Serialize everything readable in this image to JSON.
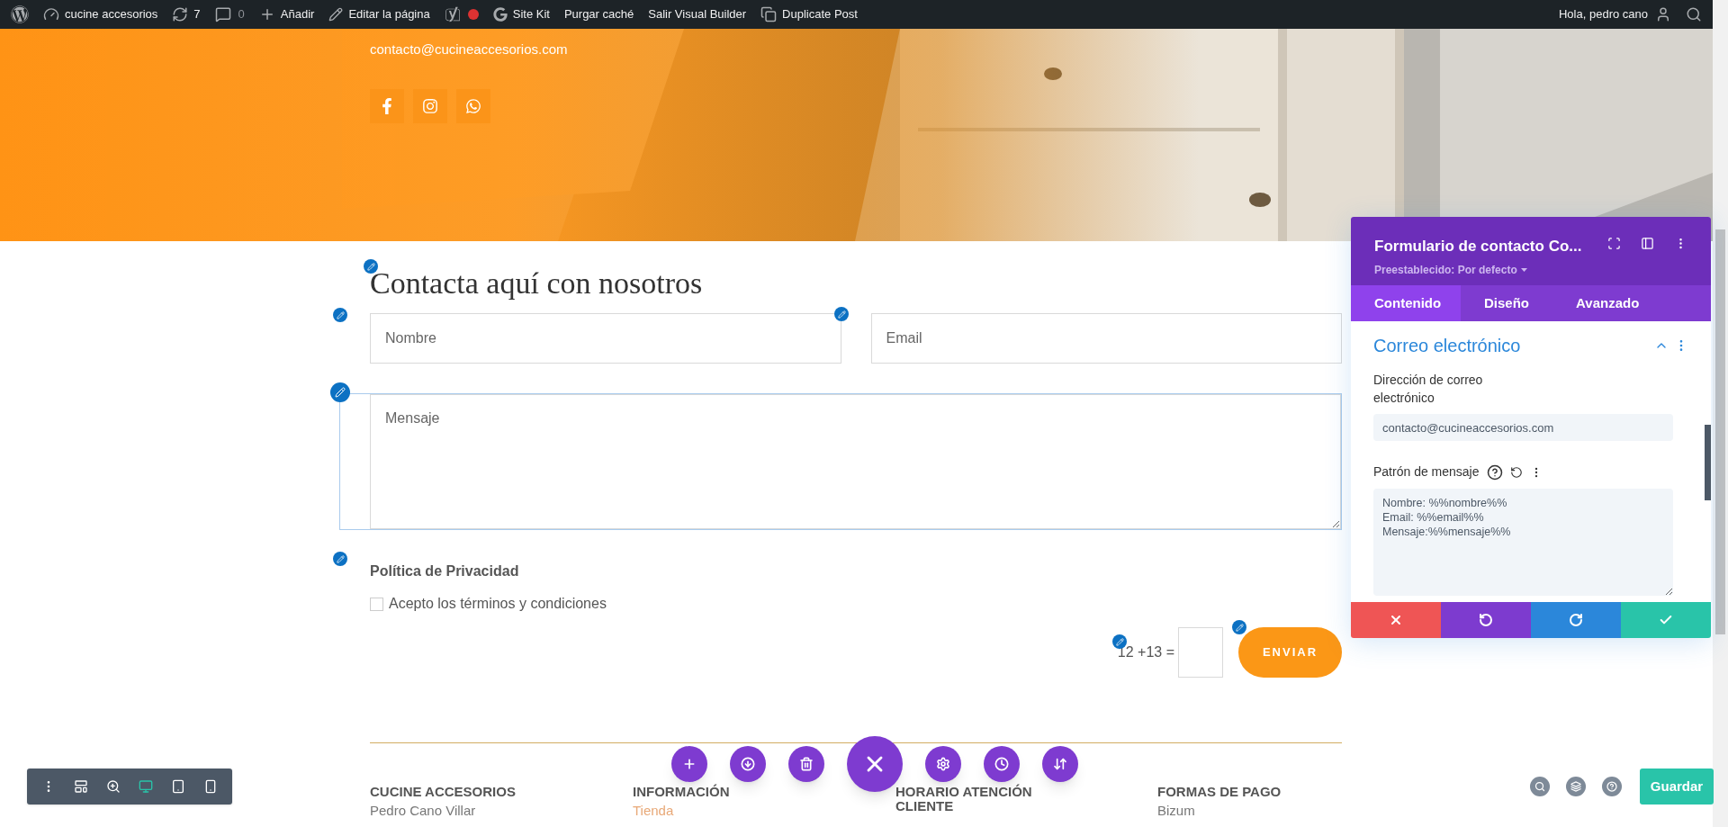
{
  "admin_bar": {
    "items": [
      {
        "kind": "wordpress"
      },
      {
        "kind": "dashboard",
        "label": "cucine accesorios"
      },
      {
        "kind": "updates",
        "label": "7"
      },
      {
        "kind": "comments",
        "label": "0"
      },
      {
        "kind": "add",
        "label": "Añadir"
      },
      {
        "kind": "edit",
        "label": "Editar la página"
      },
      {
        "kind": "seo",
        "color": "#dc3232"
      },
      {
        "kind": "sitekit",
        "label": "Site Kit"
      },
      {
        "kind": "text",
        "label": "Purgar caché"
      },
      {
        "kind": "text",
        "label": "Salir Visual Builder"
      },
      {
        "kind": "duplicate",
        "label": "Duplicate Post"
      }
    ],
    "greeting": "Hola, pedro cano"
  },
  "hero": {
    "email": "contacto@cucineaccesorios.com",
    "social": [
      {
        "kind": "facebook"
      },
      {
        "kind": "instagram"
      },
      {
        "kind": "whatsapp"
      }
    ]
  },
  "form": {
    "heading": "Contacta aquí con nosotros",
    "fields": [
      {
        "placeholder": "Nombre"
      },
      {
        "placeholder": "Email"
      }
    ],
    "message": {
      "placeholder": "Mensaje",
      "selected": true
    },
    "privacy_title": "Política de Privacidad",
    "consent": {
      "label": "Acepto los términos y condiciones",
      "checked": false
    },
    "captcha": "12 +13 =",
    "submit": "ENVIAR"
  },
  "footer": {
    "columns": [
      {
        "heading": "CUCINE ACCESORIOS",
        "line": "Pedro Cano Villar",
        "link": false
      },
      {
        "heading": "INFORMACIÓN",
        "line": "Tienda",
        "link": true
      },
      {
        "heading": "HORARIO ATENCIÓN CLIENTE"
      },
      {
        "heading": "FORMAS DE PAGO",
        "line": "Bizum",
        "link": false
      }
    ]
  },
  "settings_panel": {
    "title": "Formulario de contacto Co...",
    "preset": "Preestablecido: Por defecto",
    "tabs": [
      {
        "label": "Contenido",
        "selected": true
      },
      {
        "label": "Diseño",
        "selected": false
      },
      {
        "label": "Avanzado",
        "selected": false
      }
    ],
    "section": {
      "title": "Correo electrónico",
      "expanded": true
    },
    "email_label": "Dirección de correo electrónico",
    "email_value": "contacto@cucineaccesorios.com",
    "pattern_label": "Patrón de mensaje",
    "pattern_value": "Nombre: %%nombre%%\nEmail: %%email%%\nMensaje:%%mensaje%%",
    "actions": [
      {
        "kind": "discard"
      },
      {
        "kind": "undo"
      },
      {
        "kind": "redo"
      },
      {
        "kind": "save"
      }
    ]
  },
  "view_toolbar": {
    "items": [
      {
        "kind": "menu",
        "selected": false
      },
      {
        "kind": "wireframe",
        "selected": false
      },
      {
        "kind": "zoom",
        "selected": false
      },
      {
        "kind": "desktop",
        "selected": true
      },
      {
        "kind": "tablet",
        "selected": false
      },
      {
        "kind": "phone",
        "selected": false
      }
    ]
  },
  "page_actions": [
    {
      "kind": "add"
    },
    {
      "kind": "portability"
    },
    {
      "kind": "delete"
    },
    {
      "kind": "close"
    },
    {
      "kind": "settings"
    },
    {
      "kind": "history"
    },
    {
      "kind": "reorder"
    }
  ],
  "right_actions": [
    {
      "kind": "search"
    },
    {
      "kind": "layers"
    },
    {
      "kind": "help"
    }
  ],
  "save_button": "Guardar"
}
